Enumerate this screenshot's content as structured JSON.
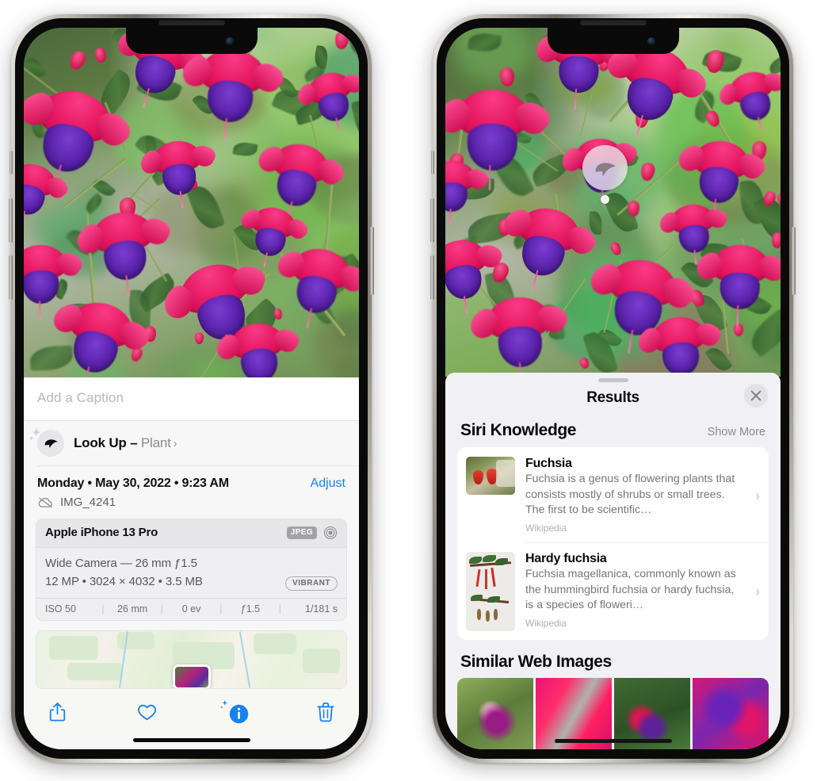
{
  "device": {
    "name": "iPhone 13 Pro",
    "notch_camera_icon": "front-camera-icon",
    "home_indicator": "home-indicator"
  },
  "left_phone": {
    "caption": {
      "placeholder": "Add a Caption",
      "value": ""
    },
    "lookup": {
      "icon": "leaf-icon",
      "sparkle_icon": "sparkles-icon",
      "label": "Look Up",
      "dash": " – ",
      "subject": "Plant",
      "chevron": "›"
    },
    "meta": {
      "date": "Monday • May 30, 2022 • 9:23 AM",
      "adjust_label": "Adjust",
      "cloud_icon": "cloud-slash-icon",
      "filename": "IMG_4241"
    },
    "camera_card": {
      "model": "Apple iPhone 13 Pro",
      "format_badge": "JPEG",
      "aperture_icon": "aperture-icon",
      "lens_line": "Wide Camera — 26 mm ƒ1.5",
      "specs_line": "12 MP • 3024 × 4032 • 3.5 MB",
      "style_badge": "VIBRANT",
      "exif": [
        "ISO 50",
        "26 mm",
        "0 ev",
        "ƒ1.5",
        "1/181 s"
      ]
    },
    "map": {
      "pin": "photo-location-pin"
    },
    "toolbar": [
      {
        "name": "share-icon",
        "glyph": "share"
      },
      {
        "name": "heart-icon",
        "glyph": "heart"
      },
      {
        "name": "info-icon",
        "glyph": "info",
        "active": true
      },
      {
        "name": "trash-icon",
        "glyph": "trash"
      }
    ],
    "accent_color": "#1782f5"
  },
  "right_phone": {
    "lookup_pin": {
      "icon": "leaf-icon"
    },
    "sheet": {
      "grabber": "sheet-grabber",
      "title": "Results",
      "close_icon": "close-icon"
    },
    "siri_knowledge": {
      "title": "Siri Knowledge",
      "show_more": "Show More",
      "items": [
        {
          "title": "Fuchsia",
          "description": "Fuchsia is a genus of flowering plants that consists mostly of shrubs or small trees. The first to be scientific…",
          "source": "Wikipedia",
          "chevron": "›"
        },
        {
          "title": "Hardy fuchsia",
          "description": "Fuchsia magellanica, commonly known as the hummingbird fuchsia or hardy fuchsia, is a species of floweri…",
          "source": "Wikipedia",
          "chevron": "›"
        }
      ]
    },
    "similar_web_images": {
      "title": "Similar Web Images",
      "count": 4
    }
  },
  "colors": {
    "accent": "#1782f5",
    "sheet_bg": "#f1f1f5",
    "card_bg": "#ffffff",
    "text_primary": "#09090b",
    "text_secondary": "#76767c"
  }
}
